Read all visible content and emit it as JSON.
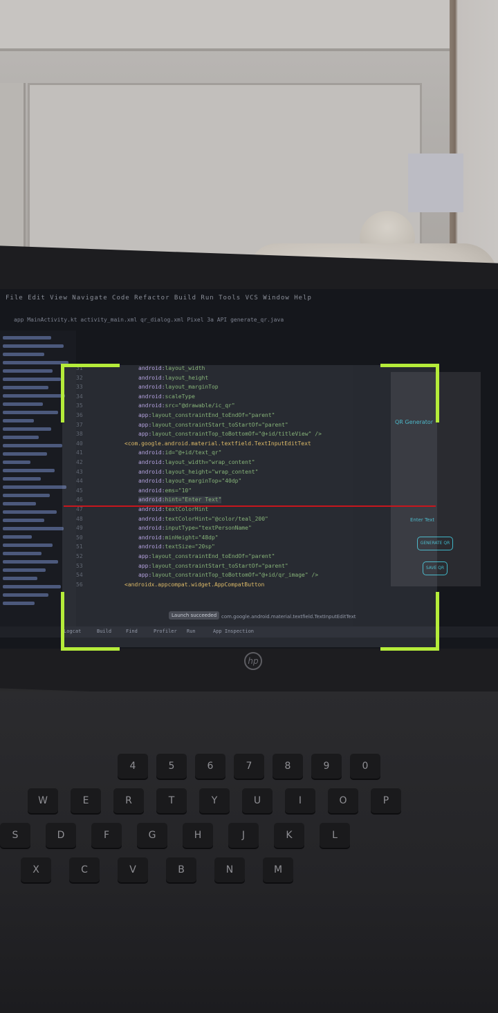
{
  "colors": {
    "viewfinder_corner": "#b5ec3a",
    "scan_line": "#c8161d"
  },
  "menubar": {
    "text": "File  Edit  View  Navigate  Code  Refactor  Build  Run  Tools  VCS  Window  Help"
  },
  "toolbar": {
    "text": "app   MainActivity.kt   activity_main.xml   qr_dialog.xml   Pixel 3a API   generate_qr.java"
  },
  "editor": {
    "lines": [
      {
        "num": "31",
        "attr": "android:",
        "rest": "layout_width"
      },
      {
        "num": "32",
        "attr": "android:",
        "rest": "layout_height"
      },
      {
        "num": "33",
        "attr": "android:",
        "rest": "layout_marginTop"
      },
      {
        "num": "34",
        "attr": "android:",
        "rest": "scaleType"
      },
      {
        "num": "35",
        "attr": "android:",
        "rest": "src=\"@drawable/ic_qr\""
      },
      {
        "num": "36",
        "attr": "app:",
        "rest": "layout_constraintEnd_toEndOf=\"parent\""
      },
      {
        "num": "37",
        "attr": "app:",
        "rest": "layout_constraintStart_toStartOf=\"parent\""
      },
      {
        "num": "38",
        "attr": "app:",
        "rest": "layout_constraintTop_toBottomOf=\"@+id/titleView\" />"
      },
      {
        "num": "40",
        "tag": "<com.google.android.material.textfield.TextInputEditText"
      },
      {
        "num": "41",
        "attr": "android:",
        "rest": "id=\"@+id/text_qr\""
      },
      {
        "num": "42",
        "attr": "android:",
        "rest": "layout_width=\"wrap_content\""
      },
      {
        "num": "43",
        "attr": "android:",
        "rest": "layout_height=\"wrap_content\""
      },
      {
        "num": "44",
        "attr": "android:",
        "rest": "layout_marginTop=\"40dp\""
      },
      {
        "num": "45",
        "attr": "android:",
        "rest": "ems=\"10\""
      },
      {
        "num": "46",
        "attr": "android:",
        "rest": "hint=\"Enter Text\""
      },
      {
        "num": "47",
        "attr": "android:",
        "rest": "textColorHint"
      },
      {
        "num": "48",
        "attr": "android:",
        "rest": "textColorHint=\"@color/teal_200\""
      },
      {
        "num": "49",
        "attr": "android:",
        "rest": "inputType=\"textPersonName\""
      },
      {
        "num": "50",
        "attr": "android:",
        "rest": "minHeight=\"48dp\""
      },
      {
        "num": "51",
        "attr": "android:",
        "rest": "textSize=\"20sp\""
      },
      {
        "num": "52",
        "attr": "app:",
        "rest": "layout_constraintEnd_toEndOf=\"parent\""
      },
      {
        "num": "53",
        "attr": "app:",
        "rest": "layout_constraintStart_toStartOf=\"parent\""
      },
      {
        "num": "54",
        "attr": "app:",
        "rest": "layout_constraintTop_toBottomOf=\"@+id/qr_image\" />"
      },
      {
        "num": "56",
        "tag": "<androidx.appcompat.widget.AppCompatButton"
      }
    ]
  },
  "preview": {
    "title": "QR Generator",
    "enter_text": "Enter Text",
    "generate_btn": "GENERATE QR",
    "save_btn": "SAVE QR"
  },
  "tooltip": "Launch succeeded",
  "breadcrumb": "com.google.android.material.textfield.TextInputEditText",
  "statusbar": {
    "logcat": "Logcat",
    "build": "Build",
    "find": "Find",
    "profiler": "Profiler",
    "run": "Run",
    "inspection": "App Inspection"
  },
  "hp_logo": "hp",
  "keyboard_keys": [
    "4",
    "5",
    "6",
    "7",
    "8",
    "9",
    "0",
    "W",
    "E",
    "R",
    "T",
    "Y",
    "U",
    "I",
    "O",
    "P",
    "S",
    "D",
    "F",
    "G",
    "H",
    "J",
    "K",
    "L",
    "X",
    "C",
    "V",
    "B",
    "N",
    "M"
  ]
}
